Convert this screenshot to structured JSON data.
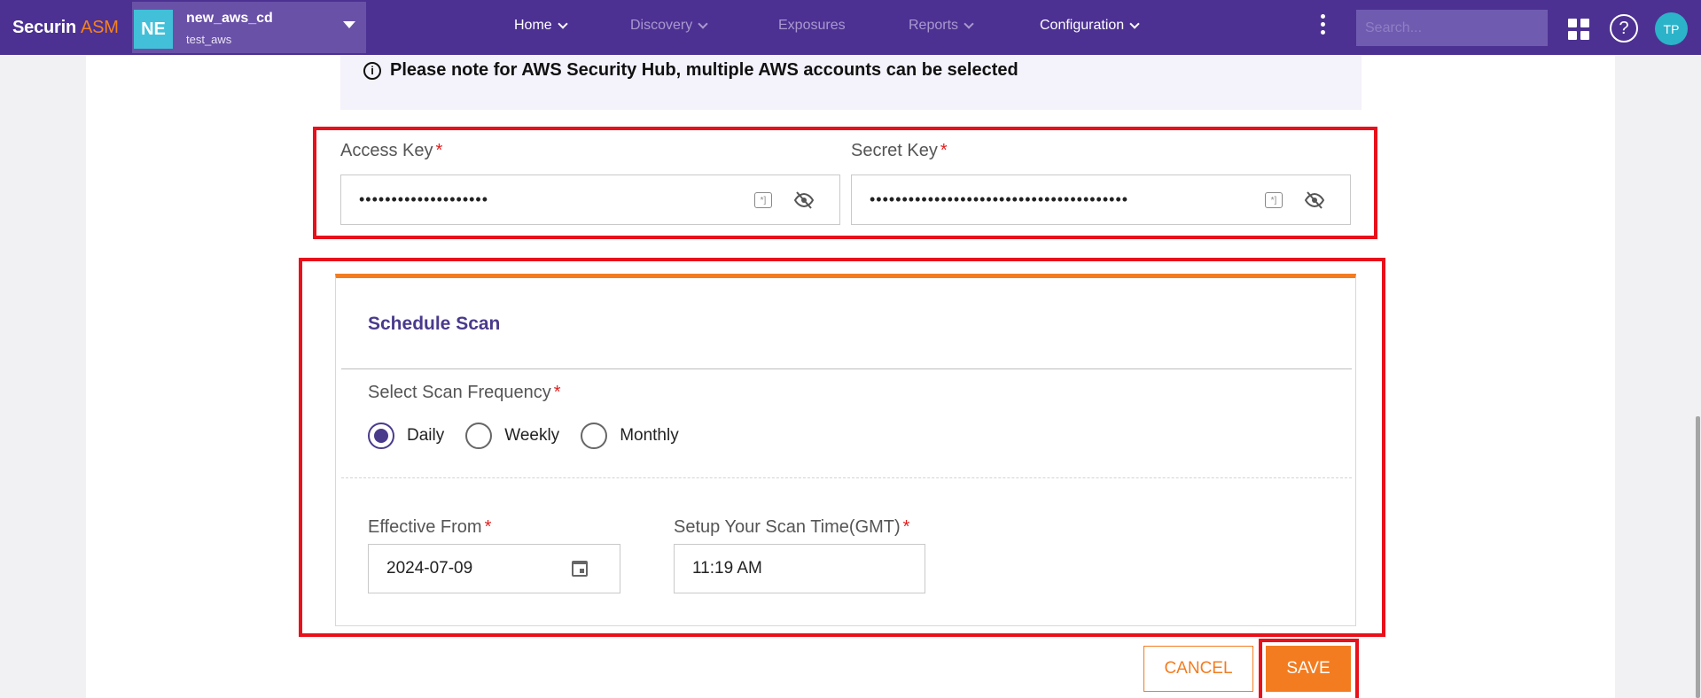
{
  "brand": {
    "name": "Securin",
    "suffix": "ASM"
  },
  "org": {
    "initials": "NE",
    "name": "new_aws_cd",
    "sub": "test_aws"
  },
  "nav": [
    {
      "label": "Home",
      "has_menu": true,
      "state": "active"
    },
    {
      "label": "Discovery",
      "has_menu": true,
      "state": "dim"
    },
    {
      "label": "Exposures",
      "has_menu": false,
      "state": "dim"
    },
    {
      "label": "Reports",
      "has_menu": true,
      "state": "dim"
    },
    {
      "label": "Configuration",
      "has_menu": true,
      "state": "active"
    }
  ],
  "search": {
    "placeholder": "Search..."
  },
  "user": {
    "initials": "TP"
  },
  "note": {
    "text": "Please note for AWS Security Hub, multiple AWS accounts can be selected"
  },
  "credentials": {
    "access_key": {
      "label": "Access Key",
      "required": "*",
      "value": "••••••••••••••••••••"
    },
    "secret_key": {
      "label": "Secret Key",
      "required": "*",
      "value": "••••••••••••••••••••••••••••••••••••••••"
    }
  },
  "schedule": {
    "title": "Schedule Scan",
    "frequency_label": "Select Scan Frequency",
    "required": "*",
    "options": [
      "Daily",
      "Weekly",
      "Monthly"
    ],
    "selected": "Daily",
    "effective_from_label": "Effective From",
    "effective_from_value": "2024-07-09",
    "scan_time_label": "Setup Your Scan Time(GMT)",
    "scan_time_value": "11:19 AM"
  },
  "actions": {
    "cancel": "CANCEL",
    "save": "SAVE"
  },
  "colors": {
    "nav_bg": "#4c3192",
    "accent": "#f37c20",
    "highlight": "#e8101a",
    "title": "#4a3a8c"
  }
}
